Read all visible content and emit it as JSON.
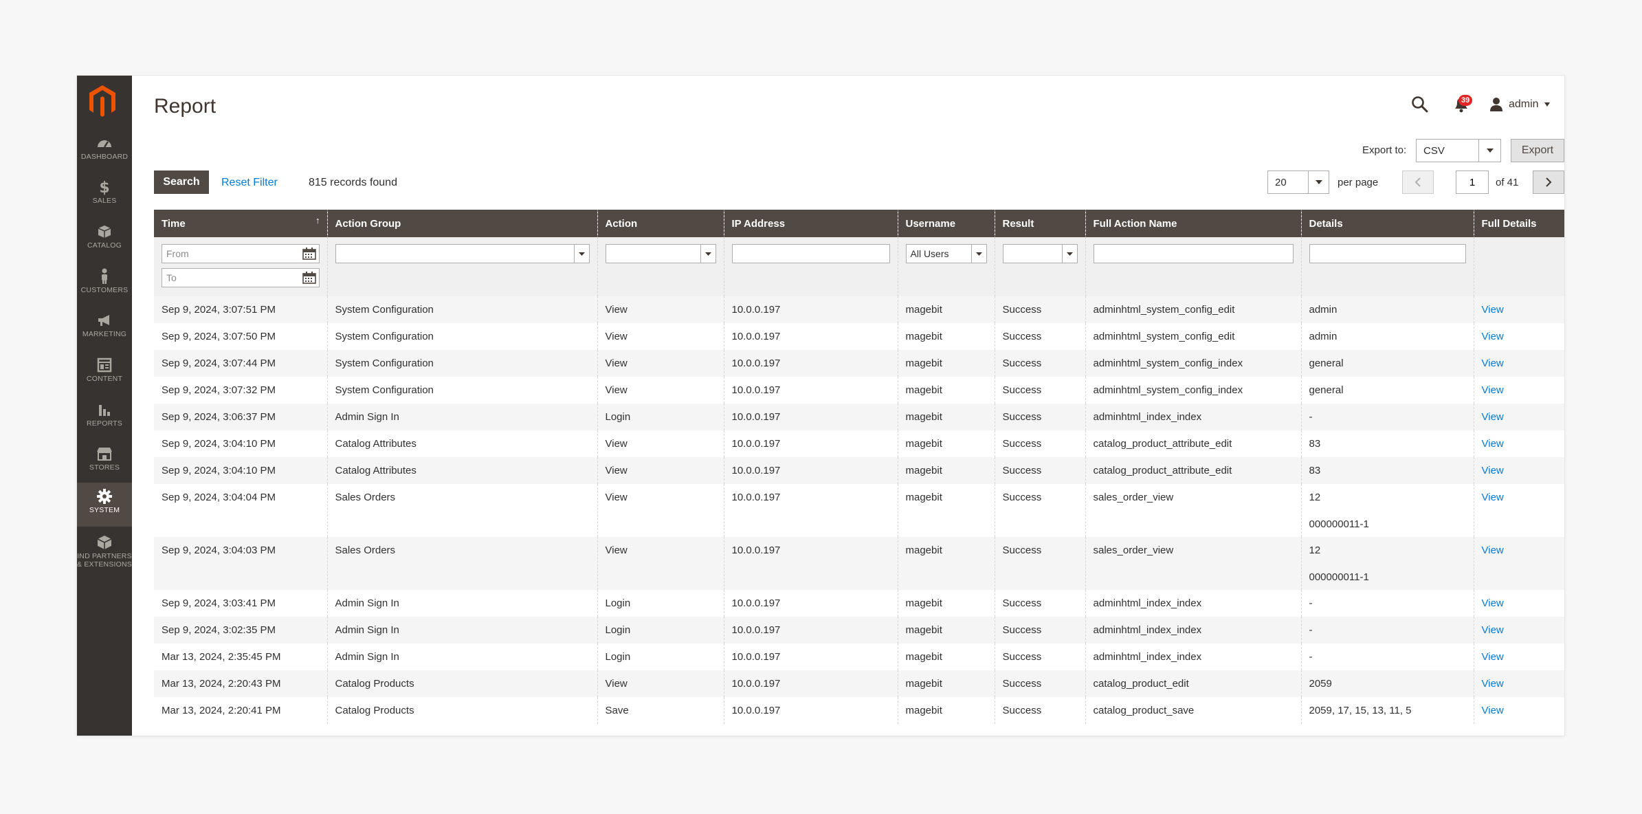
{
  "page": {
    "title": "Report"
  },
  "sidebar": {
    "items": [
      {
        "label": "DASHBOARD",
        "icon": "dashboard-icon"
      },
      {
        "label": "SALES",
        "icon": "dollar-icon"
      },
      {
        "label": "CATALOG",
        "icon": "box-icon"
      },
      {
        "label": "CUSTOMERS",
        "icon": "person-icon"
      },
      {
        "label": "MARKETING",
        "icon": "megaphone-icon"
      },
      {
        "label": "CONTENT",
        "icon": "layout-icon"
      },
      {
        "label": "REPORTS",
        "icon": "bar-chart-icon"
      },
      {
        "label": "STORES",
        "icon": "storefront-icon"
      },
      {
        "label": "SYSTEM",
        "icon": "gear-icon",
        "active": true
      },
      {
        "label": "IND PARTNERS",
        "label2": "& EXTENSIONS",
        "icon": "extensions-icon"
      }
    ]
  },
  "header": {
    "notifications": "39",
    "user": "admin"
  },
  "toolbar": {
    "export_label": "Export to:",
    "export_format": "CSV",
    "export_button": "Export",
    "search_button": "Search",
    "reset_filter": "Reset Filter",
    "records_found": "815 records found",
    "per_page_value": "20",
    "per_page_label": "per page",
    "current_page": "1",
    "page_of": "of 41"
  },
  "grid": {
    "columns": [
      "Time",
      "Action Group",
      "Action",
      "IP Address",
      "Username",
      "Result",
      "Full Action Name",
      "Details",
      "Full Details"
    ],
    "filters": {
      "from_placeholder": "From",
      "to_placeholder": "To",
      "username_value": "All Users"
    },
    "rows": [
      {
        "time": "Sep 9, 2024, 3:07:51 PM",
        "group": "System Configuration",
        "action": "View",
        "ip": "10.0.0.197",
        "user": "magebit",
        "result": "Success",
        "full_action": "adminhtml_system_config_edit",
        "details": "admin",
        "details2": "",
        "link": "View"
      },
      {
        "time": "Sep 9, 2024, 3:07:50 PM",
        "group": "System Configuration",
        "action": "View",
        "ip": "10.0.0.197",
        "user": "magebit",
        "result": "Success",
        "full_action": "adminhtml_system_config_edit",
        "details": "admin",
        "details2": "",
        "link": "View"
      },
      {
        "time": "Sep 9, 2024, 3:07:44 PM",
        "group": "System Configuration",
        "action": "View",
        "ip": "10.0.0.197",
        "user": "magebit",
        "result": "Success",
        "full_action": "adminhtml_system_config_index",
        "details": "general",
        "details2": "",
        "link": "View"
      },
      {
        "time": "Sep 9, 2024, 3:07:32 PM",
        "group": "System Configuration",
        "action": "View",
        "ip": "10.0.0.197",
        "user": "magebit",
        "result": "Success",
        "full_action": "adminhtml_system_config_index",
        "details": "general",
        "details2": "",
        "link": "View"
      },
      {
        "time": "Sep 9, 2024, 3:06:37 PM",
        "group": "Admin Sign In",
        "action": "Login",
        "ip": "10.0.0.197",
        "user": "magebit",
        "result": "Success",
        "full_action": "adminhtml_index_index",
        "details": "-",
        "details2": "",
        "link": "View"
      },
      {
        "time": "Sep 9, 2024, 3:04:10 PM",
        "group": "Catalog Attributes",
        "action": "View",
        "ip": "10.0.0.197",
        "user": "magebit",
        "result": "Success",
        "full_action": "catalog_product_attribute_edit",
        "details": "83",
        "details2": "",
        "link": "View"
      },
      {
        "time": "Sep 9, 2024, 3:04:10 PM",
        "group": "Catalog Attributes",
        "action": "View",
        "ip": "10.0.0.197",
        "user": "magebit",
        "result": "Success",
        "full_action": "catalog_product_attribute_edit",
        "details": "83",
        "details2": "",
        "link": "View"
      },
      {
        "time": "Sep 9, 2024, 3:04:04 PM",
        "group": "Sales Orders",
        "action": "View",
        "ip": "10.0.0.197",
        "user": "magebit",
        "result": "Success",
        "full_action": "sales_order_view",
        "details": "12",
        "details2": "000000011-1",
        "link": "View"
      },
      {
        "time": "Sep 9, 2024, 3:04:03 PM",
        "group": "Sales Orders",
        "action": "View",
        "ip": "10.0.0.197",
        "user": "magebit",
        "result": "Success",
        "full_action": "sales_order_view",
        "details": "12",
        "details2": "000000011-1",
        "link": "View"
      },
      {
        "time": "Sep 9, 2024, 3:03:41 PM",
        "group": "Admin Sign In",
        "action": "Login",
        "ip": "10.0.0.197",
        "user": "magebit",
        "result": "Success",
        "full_action": "adminhtml_index_index",
        "details": "-",
        "details2": "",
        "link": "View"
      },
      {
        "time": "Sep 9, 2024, 3:02:35 PM",
        "group": "Admin Sign In",
        "action": "Login",
        "ip": "10.0.0.197",
        "user": "magebit",
        "result": "Success",
        "full_action": "adminhtml_index_index",
        "details": "-",
        "details2": "",
        "link": "View"
      },
      {
        "time": "Mar 13, 2024, 2:35:45 PM",
        "group": "Admin Sign In",
        "action": "Login",
        "ip": "10.0.0.197",
        "user": "magebit",
        "result": "Success",
        "full_action": "adminhtml_index_index",
        "details": "-",
        "details2": "",
        "link": "View"
      },
      {
        "time": "Mar 13, 2024, 2:20:43 PM",
        "group": "Catalog Products",
        "action": "View",
        "ip": "10.0.0.197",
        "user": "magebit",
        "result": "Success",
        "full_action": "catalog_product_edit",
        "details": "2059",
        "details2": "",
        "link": "View"
      },
      {
        "time": "Mar 13, 2024, 2:20:41 PM",
        "group": "Catalog Products",
        "action": "Save",
        "ip": "10.0.0.197",
        "user": "magebit",
        "result": "Success",
        "full_action": "catalog_product_save",
        "details": "2059, 17, 15, 13, 11, 5",
        "details2": "",
        "link": "View"
      }
    ]
  },
  "colors": {
    "sidebar_bg": "#373330",
    "header_bg": "#514943",
    "link": "#007bdb",
    "brand": "#eb5202"
  }
}
